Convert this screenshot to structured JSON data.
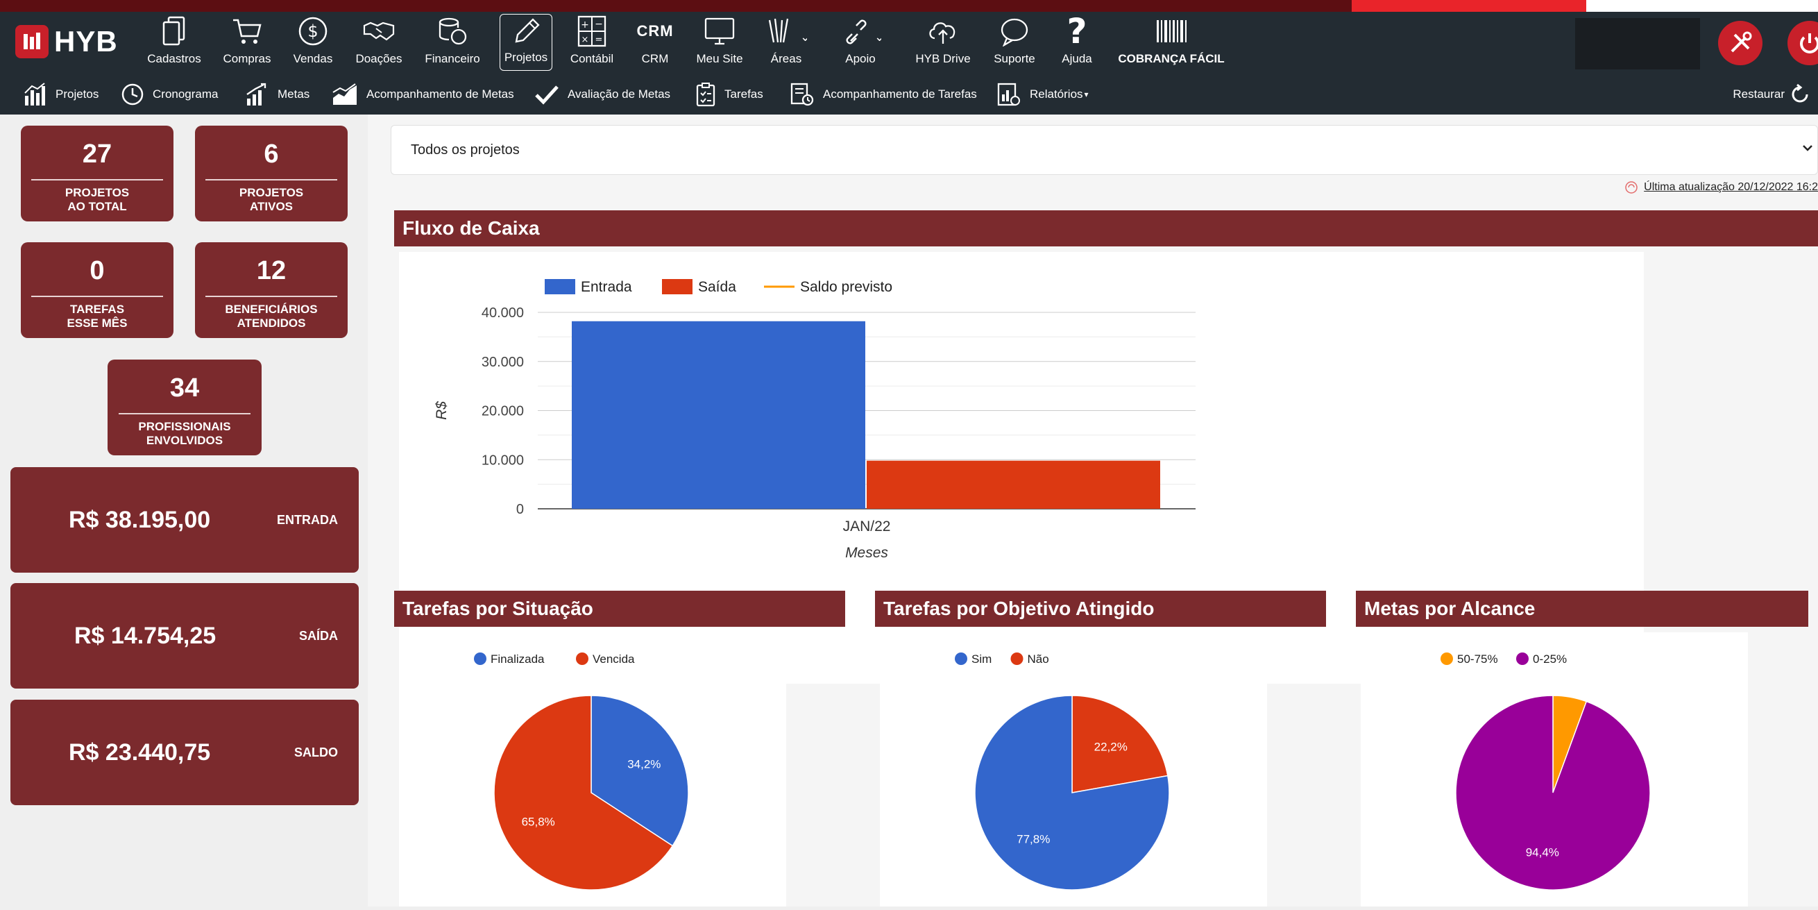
{
  "topnav": {
    "logo": "HYB",
    "items": [
      {
        "label": "Cadastros",
        "icon": "copy-icon"
      },
      {
        "label": "Compras",
        "icon": "cart-icon"
      },
      {
        "label": "Vendas",
        "icon": "dollar-circle-icon"
      },
      {
        "label": "Doações",
        "icon": "handshake-icon"
      },
      {
        "label": "Financeiro",
        "icon": "coins-icon"
      },
      {
        "label": "Projetos",
        "icon": "pencil-icon"
      },
      {
        "label": "Contábil",
        "icon": "calculator-icon"
      },
      {
        "label": "CRM",
        "icon": "crm-text-icon",
        "icon_text": "CRM"
      },
      {
        "label": "Meu Site",
        "icon": "monitor-icon"
      },
      {
        "label": "Áreas",
        "icon": "areas-icon"
      },
      {
        "label": "Apoio",
        "icon": "link-icon"
      },
      {
        "label": "HYB Drive",
        "icon": "cloud-upload-icon"
      },
      {
        "label": "Suporte",
        "icon": "chat-icon"
      },
      {
        "label": "Ajuda",
        "icon": "question-icon"
      },
      {
        "label": "COBRANÇA FÁCIL",
        "icon": "barcode-icon"
      }
    ]
  },
  "subnav": {
    "items": [
      {
        "label": "Projetos",
        "icon": "bar-chart-icon"
      },
      {
        "label": "Cronograma",
        "icon": "clock-icon"
      },
      {
        "label": "Metas",
        "icon": "growth-chart-icon"
      },
      {
        "label": "Acompanhamento de Metas",
        "icon": "area-chart-icon"
      },
      {
        "label": "Avaliação de Metas",
        "icon": "check-icon"
      },
      {
        "label": "Tarefas",
        "icon": "clipboard-icon"
      },
      {
        "label": "Acompanhamento de Tarefas",
        "icon": "task-track-icon"
      },
      {
        "label": "Relatórios",
        "icon": "report-icon"
      }
    ],
    "restore_label": "Restaurar"
  },
  "stats": [
    {
      "value": "27",
      "label_line1": "PROJETOS",
      "label_line2": "AO TOTAL"
    },
    {
      "value": "6",
      "label_line1": "PROJETOS",
      "label_line2": "ATIVOS"
    },
    {
      "value": "0",
      "label_line1": "TAREFAS",
      "label_line2": "ESSE MÊS"
    },
    {
      "value": "12",
      "label_line1": "BENEFICIÁRIOS",
      "label_line2": "ATENDIDOS"
    },
    {
      "value": "34",
      "label_line1": "PROFISSIONAIS",
      "label_line2": "ENVOLVIDOS"
    }
  ],
  "money": [
    {
      "value": "R$ 38.195,00",
      "label": "ENTRADA"
    },
    {
      "value": "R$ 14.754,25",
      "label": "SAÍDA"
    },
    {
      "value": "R$ 23.440,75",
      "label": "SALDO"
    }
  ],
  "filter": {
    "selected": "Todos os projetos"
  },
  "last_update": "Última atualização 20/12/2022 16:2",
  "panels": {
    "cashflow_title": "Fluxo de Caixa",
    "tasks_status_title": "Tarefas por Situação",
    "tasks_goal_title": "Tarefas por Objetivo Atingido",
    "goals_reach_title": "Metas por Alcance"
  },
  "colors": {
    "brand": "#7b2a2d",
    "nav": "#232c33",
    "blue": "#3366cc",
    "red": "#dc3912",
    "orange": "#ff9900",
    "purple": "#990099"
  },
  "chart_data": [
    {
      "type": "bar",
      "categories": [
        "JAN/22"
      ],
      "series": [
        {
          "name": "Entrada",
          "values": [
            38195
          ],
          "color": "#3366cc"
        },
        {
          "name": "Saída",
          "values": [
            9800
          ],
          "color": "#dc3912"
        },
        {
          "name": "Saldo previsto",
          "values": [
            null
          ],
          "color": "#ff9900"
        }
      ],
      "xlabel": "Meses",
      "ylabel": "R$",
      "ylim": [
        0,
        40000
      ],
      "yticks": [
        "0",
        "10.000",
        "20.000",
        "30.000",
        "40.000"
      ],
      "legend": "top-left"
    },
    {
      "type": "pie",
      "slices": [
        {
          "label": "Finalizada",
          "value": 34.2,
          "display": "34,2%",
          "color": "#3366cc"
        },
        {
          "label": "Vencida",
          "value": 65.8,
          "display": "65,8%",
          "color": "#dc3912"
        }
      ]
    },
    {
      "type": "pie",
      "slices": [
        {
          "label": "Sim",
          "value": 77.8,
          "display": "77,8%",
          "color": "#3366cc"
        },
        {
          "label": "Não",
          "value": 22.2,
          "display": "22,2%",
          "color": "#dc3912"
        }
      ]
    },
    {
      "type": "pie",
      "slices": [
        {
          "label": "50-75%",
          "value": 5.6,
          "display": "",
          "color": "#ff9900"
        },
        {
          "label": "0-25%",
          "value": 94.4,
          "display": "94,4%",
          "color": "#990099"
        }
      ]
    }
  ]
}
